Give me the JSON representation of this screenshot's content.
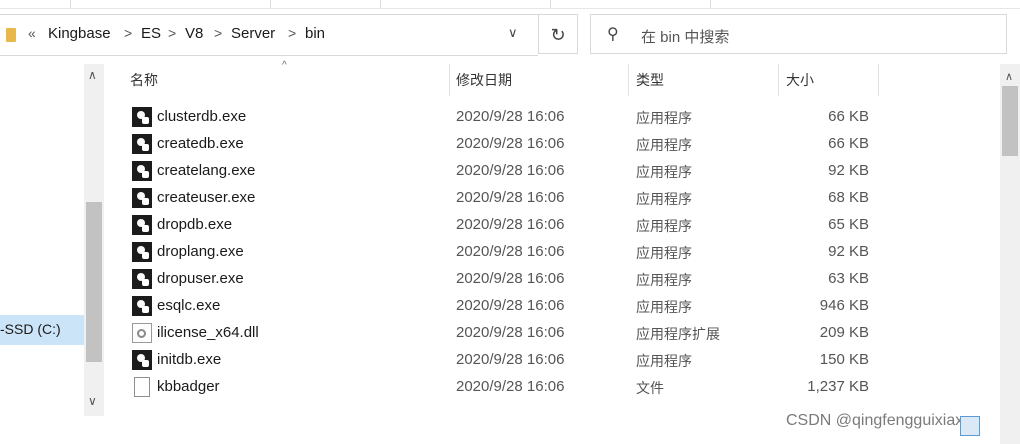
{
  "address": {
    "back_glyph": "«",
    "crumbs": [
      "Kingbase",
      "ES",
      "V8",
      "Server",
      "bin"
    ],
    "separator": ">",
    "dropdown_glyph": "∨",
    "refresh_glyph": "↻"
  },
  "search": {
    "placeholder": "在 bin 中搜索",
    "icon": "search-icon"
  },
  "nav": {
    "drive_label": "-SSD (C:)"
  },
  "columns": {
    "name": "名称",
    "date": "修改日期",
    "type": "类型",
    "size": "大小"
  },
  "files": [
    {
      "name": "clusterdb.exe",
      "date": "2020/9/28 16:06",
      "type": "应用程序",
      "size": "66 KB",
      "icon": "exe-icon"
    },
    {
      "name": "createdb.exe",
      "date": "2020/9/28 16:06",
      "type": "应用程序",
      "size": "66 KB",
      "icon": "exe-icon"
    },
    {
      "name": "createlang.exe",
      "date": "2020/9/28 16:06",
      "type": "应用程序",
      "size": "92 KB",
      "icon": "exe-icon"
    },
    {
      "name": "createuser.exe",
      "date": "2020/9/28 16:06",
      "type": "应用程序",
      "size": "68 KB",
      "icon": "exe-icon"
    },
    {
      "name": "dropdb.exe",
      "date": "2020/9/28 16:06",
      "type": "应用程序",
      "size": "65 KB",
      "icon": "exe-icon"
    },
    {
      "name": "droplang.exe",
      "date": "2020/9/28 16:06",
      "type": "应用程序",
      "size": "92 KB",
      "icon": "exe-icon"
    },
    {
      "name": "dropuser.exe",
      "date": "2020/9/28 16:06",
      "type": "应用程序",
      "size": "63 KB",
      "icon": "exe-icon"
    },
    {
      "name": "esqlc.exe",
      "date": "2020/9/28 16:06",
      "type": "应用程序",
      "size": "946 KB",
      "icon": "exe-icon"
    },
    {
      "name": "ilicense_x64.dll",
      "date": "2020/9/28 16:06",
      "type": "应用程序扩展",
      "size": "209 KB",
      "icon": "dll-icon"
    },
    {
      "name": "initdb.exe",
      "date": "2020/9/28 16:06",
      "type": "应用程序",
      "size": "150 KB",
      "icon": "exe-icon"
    },
    {
      "name": "kbbadger",
      "date": "2020/9/28 16:06",
      "type": "文件",
      "size": "1,237 KB",
      "icon": "file-icon"
    }
  ],
  "watermark": "CSDN @qingfengguixiaxu"
}
